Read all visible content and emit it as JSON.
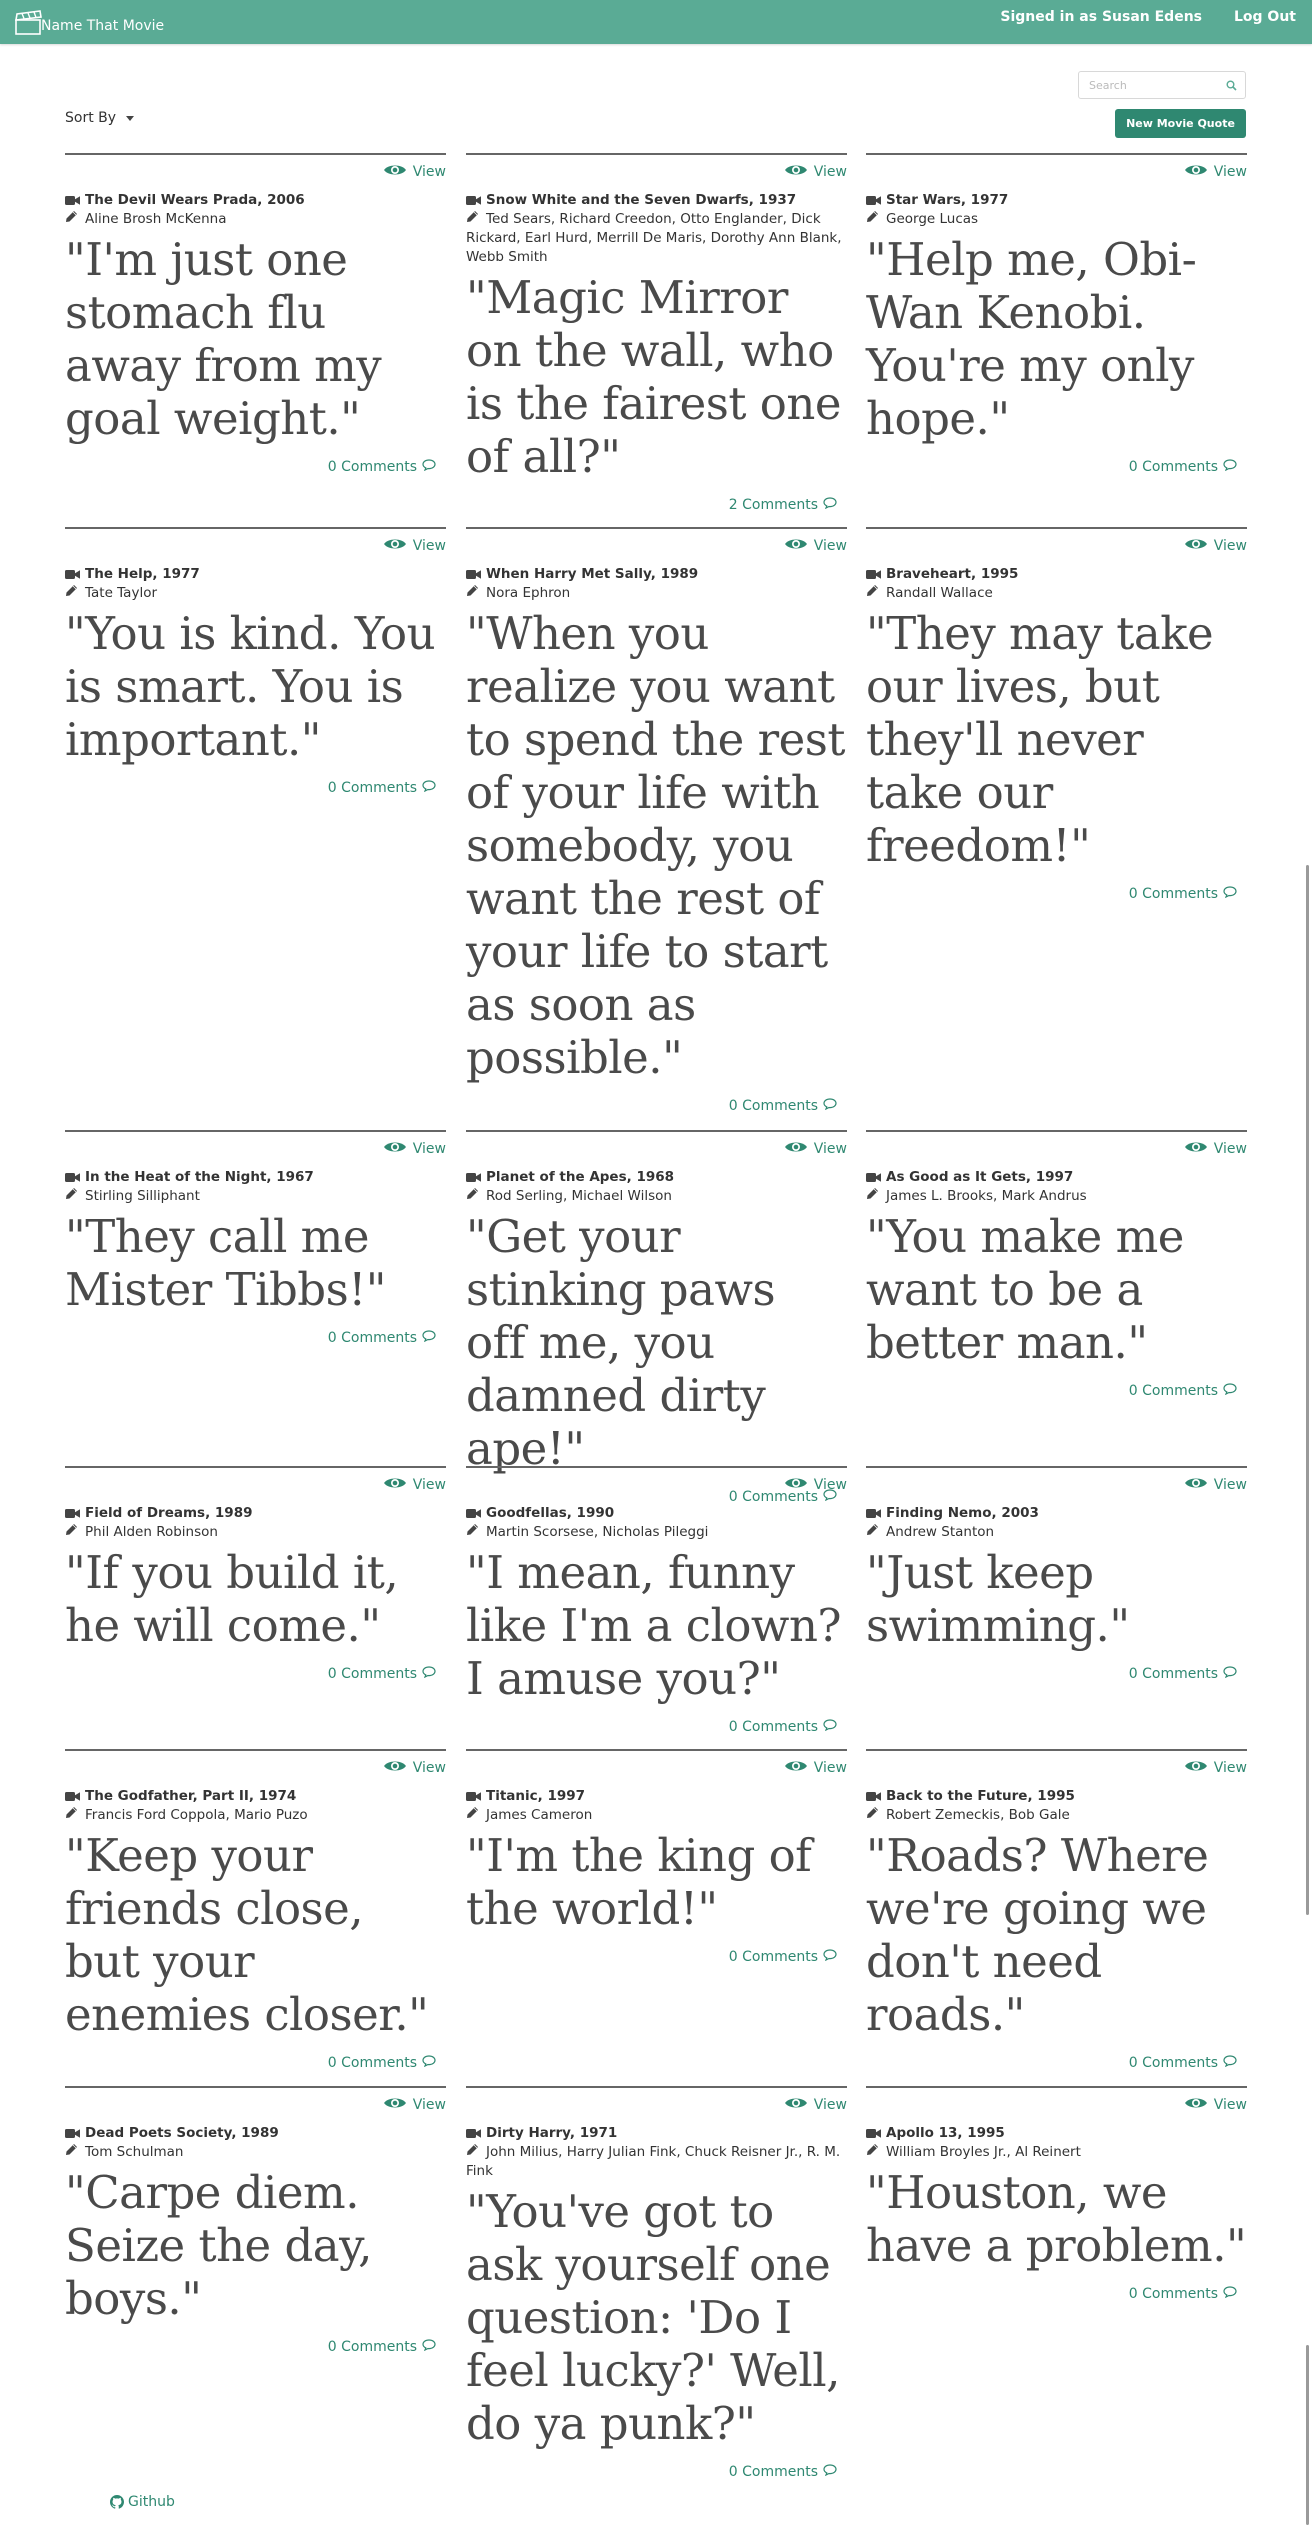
{
  "app": {
    "title": "Name That Movie"
  },
  "nav": {
    "signed_in": "Signed in as Susan Edens",
    "logout": "Log Out"
  },
  "search": {
    "placeholder": "Search"
  },
  "toolbar": {
    "sort_label": "Sort By",
    "new_quote_label": "New Movie Quote"
  },
  "view_label": "View",
  "quotes": [
    {
      "movie": "The Devil Wears Prada, 2006",
      "writers": "Aline Brosh McKenna",
      "quote": "\"I'm just one stomach flu away from my goal weight.\"",
      "comments": "0 Comments"
    },
    {
      "movie": "Snow White and the Seven Dwarfs, 1937",
      "writers": "Ted Sears, Richard Creedon, Otto Englander, Dick Rickard, Earl Hurd, Merrill De Maris, Dorothy Ann Blank, Webb Smith",
      "quote": "\"Magic Mirror on the wall, who is the fairest one of all?\"",
      "comments": "2 Comments"
    },
    {
      "movie": "Star Wars, 1977",
      "writers": "George Lucas",
      "quote": "\"Help me, Obi-Wan Kenobi. You're my only hope.\"",
      "comments": "0 Comments"
    },
    {
      "movie": "The Help, 1977",
      "writers": "Tate Taylor",
      "quote": "\"You is kind. You is smart. You is important.\"",
      "comments": "0 Comments"
    },
    {
      "movie": "When Harry Met Sally, 1989",
      "writers": "Nora Ephron",
      "quote": "\"When you realize you want to spend the rest of your life with somebody, you want the rest of your life to start as soon as possible.\"",
      "comments": "0 Comments"
    },
    {
      "movie": "Braveheart, 1995",
      "writers": "Randall Wallace",
      "quote": "\"They may take our lives, but they'll never take our freedom!\"",
      "comments": "0 Comments"
    },
    {
      "movie": "In the Heat of the Night, 1967",
      "writers": "Stirling Silliphant",
      "quote": "\"They call me Mister Tibbs!\"",
      "comments": "0 Comments"
    },
    {
      "movie": "Planet of the Apes, 1968",
      "writers": "Rod Serling, Michael Wilson",
      "quote": "\"Get your stinking paws off me, you damned dirty ape!\"",
      "comments": "0 Comments"
    },
    {
      "movie": "As Good as It Gets, 1997",
      "writers": "James L. Brooks, Mark Andrus",
      "quote": "\"You make me want to be a better man.\"",
      "comments": "0 Comments"
    },
    {
      "movie": "Field of Dreams, 1989",
      "writers": "Phil Alden Robinson",
      "quote": "\"If you build it, he will come.\"",
      "comments": "0 Comments"
    },
    {
      "movie": "Goodfellas, 1990",
      "writers": "Martin Scorsese, Nicholas Pileggi",
      "quote": "\"I mean, funny like I'm a clown? I amuse you?\"",
      "comments": "0 Comments"
    },
    {
      "movie": "Finding Nemo, 2003",
      "writers": "Andrew Stanton",
      "quote": "\"Just keep swimming.\"",
      "comments": "0 Comments"
    },
    {
      "movie": "The Godfather, Part II, 1974",
      "writers": "Francis Ford Coppola, Mario Puzo",
      "quote": "\"Keep your friends close, but your enemies closer.\"",
      "comments": "0 Comments"
    },
    {
      "movie": "Titanic, 1997",
      "writers": "James Cameron",
      "quote": "\"I'm the king of the world!\"",
      "comments": "0 Comments"
    },
    {
      "movie": "Back to the Future, 1995",
      "writers": "Robert Zemeckis, Bob Gale",
      "quote": "\"Roads? Where we're going we don't need roads.\"",
      "comments": "0 Comments"
    },
    {
      "movie": "Dead Poets Society, 1989",
      "writers": "Tom Schulman",
      "quote": "\"Carpe diem. Seize the day, boys.\"",
      "comments": "0 Comments"
    },
    {
      "movie": "Dirty Harry, 1971",
      "writers": "John Milius, Harry Julian Fink, Chuck Reisner Jr., R. M. Fink",
      "quote": "\"You've got to ask yourself one question: 'Do I feel lucky?' Well, do ya punk?\"",
      "comments": "0 Comments"
    },
    {
      "movie": "Apollo 13, 1995",
      "writers": "William Broyles Jr., Al Reinert",
      "quote": "\"Houston, we have a problem.\"",
      "comments": "0 Comments"
    }
  ],
  "footer": {
    "github": "Github"
  },
  "icons": {
    "brand": "clapperboard-icon",
    "view": "eye-icon",
    "movie": "video-camera-icon",
    "writer": "pencil-icon",
    "comments": "comment-icon",
    "footer": "github-icon",
    "search": "search-icon"
  },
  "colors": {
    "navbar": "#5aab95",
    "accent": "#2f8871"
  }
}
